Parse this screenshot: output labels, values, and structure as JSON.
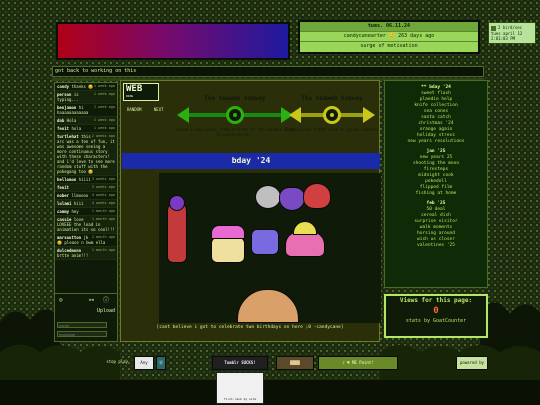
{
  "status": {
    "date": "tues. 06.11.24",
    "line": "candycanearter 😊 263 days ago",
    "mood": "surge of motivation"
  },
  "clock": {
    "label": "2 bird/sec",
    "date_line": "tues april 12 2:01:03 PM"
  },
  "marquee": "got back to working on this",
  "chat": {
    "messages": [
      {
        "name": "candy",
        "text": "thanks 😊",
        "time": "1 week ago"
      },
      {
        "name": "person",
        "text": "is typing...",
        "time": "1 week ago"
      },
      {
        "name": "benjamon",
        "text": "hi haaaaaaaaaaaa",
        "time": "1 week ago"
      },
      {
        "name": "dab",
        "text": "Hola",
        "time": "1 week ago"
      },
      {
        "name": "fenit",
        "text": "hola",
        "time": "1 week ago"
      },
      {
        "name": "turtlehat",
        "text": "this arc was a ton of fun, it was awesome seeing a more continuous story with these characters! and i'd love to see more random stuff with the pokegang too 😊",
        "time": "2 weeks ago"
      },
      {
        "name": "hellomon",
        "text": "hiiii",
        "time": "3 weeks ago"
      },
      {
        "name": "fenit",
        "text": "",
        "time": "3 weeks ago"
      },
      {
        "name": "nober",
        "text": "llmoooo",
        "time": "4 weeks ago"
      },
      {
        "name": "lulami",
        "text": "hiii",
        "time": "4 weeks ago"
      },
      {
        "name": "cammy",
        "text": "hey",
        "time": "1 month ago"
      },
      {
        "name": "cassie",
        "text": "love LOVEEE the load in animation its so cool!!!",
        "time": "1 month ago"
      },
      {
        "name": "marsoutton",
        "text": "jk 😊 please n bwm ella",
        "time": "1 month ago"
      },
      {
        "name": "dulcedmonn",
        "text": "brtte anim!!!",
        "time": "1 month ago"
      }
    ],
    "name_placeholder": "name",
    "message_placeholder": "message",
    "upload_label": "Upload"
  },
  "webring": {
    "logo": "WEB",
    "logo_sub": "RING",
    "random_label": "RANDOM",
    "next_label": "NEXT",
    "green": {
      "title": "The Seaweb Subway",
      "desc": "Green Lines Sites from artists of the Goodle Crew Discord server."
    },
    "yellow": {
      "title": "The Seaweb Subway",
      "desc": "Cosmo Lines Sites with original content"
    }
  },
  "post": {
    "title": "bday '24",
    "caption": "[cant believe i got to celebrate two birthdays on here ;0 -candycane]"
  },
  "sidebar": {
    "groups": [
      {
        "head": "** bday '24",
        "items": [
          "sweet flash",
          "plaedio help",
          "knife collection",
          "sea cones",
          "santa catch",
          "christmas '24",
          "orange again",
          "holiday stress",
          "new years resolutions"
        ]
      },
      {
        "head": "jan '25",
        "items": [
          "new years 25",
          "shooting the moon",
          "firesteps",
          "midnight cook",
          "pokedoll",
          "flipped film",
          "fishing at home"
        ]
      },
      {
        "head": "feb '25",
        "items": [
          "50 deal",
          "cereal dish",
          "surprise visitor",
          "walk moments",
          "horsing around",
          "wish us closer",
          "valentines '25"
        ]
      }
    ]
  },
  "views": {
    "label": "Views for this page:",
    "count": "0",
    "sub": "stats by GoatCounter"
  },
  "bottom": {
    "buttons": [
      "stop play",
      "Any browser",
      "Ⓐ",
      "Tumblr SUCKS!",
      "████",
      "♪ ♥ ME Paint!",
      "powered by Pokepets"
    ],
    "cursor_label": "first-rank by site"
  },
  "colors": {
    "accent_green": "#2ab010",
    "accent_yellow": "#c9c81a",
    "header_blue": "#1a2aa8",
    "views_orange": "#ff6a2a"
  }
}
